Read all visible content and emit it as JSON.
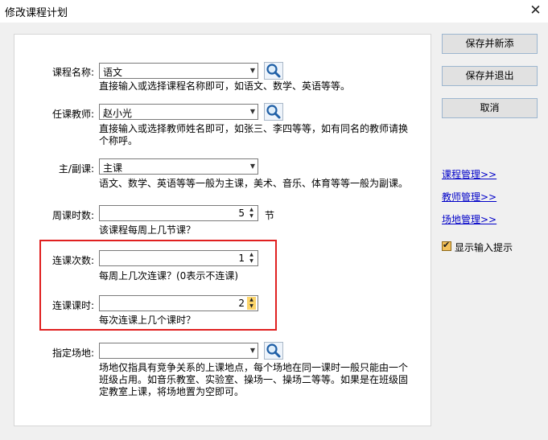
{
  "window": {
    "title": "修改课程计划",
    "close_glyph": "✕"
  },
  "fields": {
    "course_name": {
      "label": "课程名称:",
      "value": "语文",
      "hint": "直接输入或选择课程名称即可，如语文、数学、英语等等。"
    },
    "teacher": {
      "label": "任课教师:",
      "value": "赵小光",
      "hint_line1": "直接输入或选择教师姓名即可，如张三、李四等等，如有同名的教师请换",
      "hint_line2": "个称呼。"
    },
    "course_type": {
      "label": "主/副课:",
      "value": "主课",
      "hint": "语文、数学、英语等等一般为主课，美术、音乐、体育等等一般为副课。"
    },
    "weekly_hours": {
      "label": "周课时数:",
      "value": "5",
      "unit": "节",
      "hint": "该课程每周上几节课？"
    },
    "consecutive_times": {
      "label": "连课次数:",
      "value": "1",
      "hint": "每周上几次连课？(0表示不连课)"
    },
    "consecutive_hours": {
      "label": "连课课时:",
      "value": "2",
      "hint": "每次连课上几个课时？"
    },
    "venue": {
      "label": "指定场地:",
      "value": "",
      "hint_line1": "场地仅指具有竞争关系的上课地点，每个场地在同一课时一般只能由一个",
      "hint_line2": "班级占用。如音乐教室、实验室、操场一、操场二等等。如果是在班级固",
      "hint_line3": "定教室上课，将场地置为空即可。"
    }
  },
  "buttons": {
    "save_new": "保存并新添",
    "save_exit": "保存并退出",
    "cancel": "取消"
  },
  "links": {
    "course_mgmt": "课程管理>>",
    "teacher_mgmt": "教师管理>>",
    "venue_mgmt": "场地管理>>"
  },
  "show_hints": {
    "label": "显示输入提示",
    "checked": true,
    "check_glyph": "✔"
  },
  "icons": {
    "search": "search-icon",
    "dropdown": "chevron-down-icon",
    "spin": "spin-arrows-icon"
  },
  "colors": {
    "highlight_box": "#e02020",
    "link": "#0000c8",
    "spin_highlight": "#fcd56a"
  }
}
